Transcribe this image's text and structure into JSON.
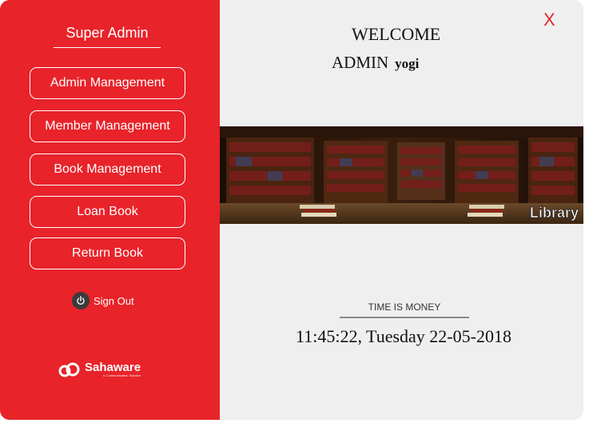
{
  "sidebar": {
    "role_title": "Super Admin",
    "menu": [
      {
        "label": "Admin Management"
      },
      {
        "label": "Member Management"
      },
      {
        "label": "Book Management"
      },
      {
        "label": "Loan Book"
      },
      {
        "label": "Return Book"
      }
    ],
    "signout_label": "Sign Out",
    "brand": {
      "name": "Sahaware",
      "tagline": "e-Communication Solution"
    }
  },
  "main": {
    "close_label": "X",
    "welcome": "WELCOME",
    "admin_prefix": "ADMIN",
    "username": "yogi",
    "banner_label": "Library",
    "time_label": "TIME IS MONEY",
    "clock_text": "11:45:22, Tuesday 22-05-2018"
  },
  "colors": {
    "accent": "#e8232a",
    "background": "#efefef",
    "text": "#111111"
  }
}
